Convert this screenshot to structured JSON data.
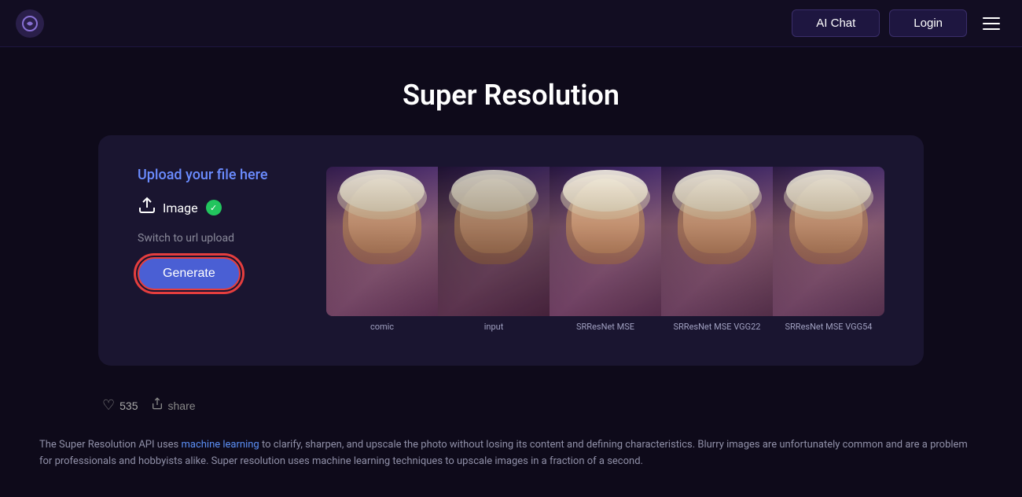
{
  "header": {
    "logo_icon": "◎",
    "nav_aichat_label": "AI Chat",
    "nav_login_label": "Login"
  },
  "page": {
    "title": "Super Resolution"
  },
  "upload_section": {
    "upload_label": "Upload your file here",
    "image_button_label": "Image",
    "switch_url_label": "Switch to url upload",
    "generate_button_label": "Generate"
  },
  "image_labels": {
    "label1": "comic",
    "label2": "input",
    "label3": "SRResNet MSE",
    "label4": "SRResNet MSE VGG22",
    "label5": "SRResNet MSE VGG54"
  },
  "bottom": {
    "like_count": "535",
    "share_label": "share"
  },
  "description": {
    "text_before_link": "The Super Resolution API uses ",
    "link_text": "machine learning",
    "text_after_link": " to clarify, sharpen, and upscale the photo without losing its content and defining characteristics. Blurry images are unfortunately common and are a problem for professionals and hobbyists alike. Super resolution uses machine learning techniques to upscale images in a fraction of a second."
  }
}
